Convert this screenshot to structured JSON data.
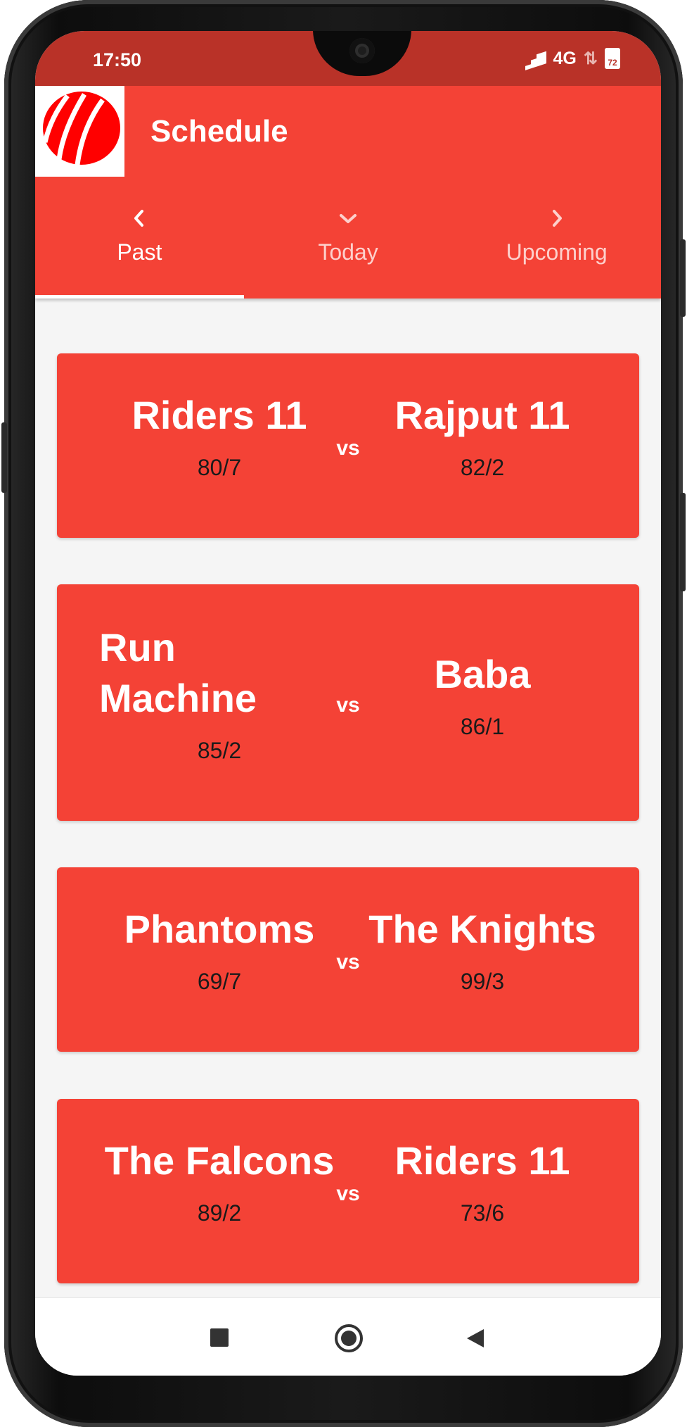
{
  "status": {
    "time": "17:50",
    "network": "4G",
    "battery": "72",
    "bar_color": "#b93228"
  },
  "app": {
    "title": "Schedule",
    "logo": "cricket-ball-logo",
    "primary_color": "#f44236"
  },
  "tabs": [
    {
      "label": "Past",
      "icon": "chevron-left-icon",
      "active": true
    },
    {
      "label": "Today",
      "icon": "chevron-down-icon",
      "active": false
    },
    {
      "label": "Upcoming",
      "icon": "chevron-right-icon",
      "active": false
    }
  ],
  "matches": [
    {
      "team1": "Riders 11",
      "score1": "80/7",
      "vs": "vs",
      "team2": "Rajput 11",
      "score2": "82/2"
    },
    {
      "team1": "Run Machine",
      "score1": "85/2",
      "vs": "vs",
      "team2": "Baba",
      "score2": "86/1"
    },
    {
      "team1": "Phantoms",
      "score1": "69/7",
      "vs": "vs",
      "team2": "The Knights",
      "score2": "99/3"
    },
    {
      "team1": "The Falcons",
      "score1": "89/2",
      "vs": "vs",
      "team2": "Riders 11",
      "score2": "73/6"
    }
  ],
  "navbar": {
    "recents": "square-icon",
    "home": "circle-icon",
    "back": "triangle-back-icon"
  }
}
